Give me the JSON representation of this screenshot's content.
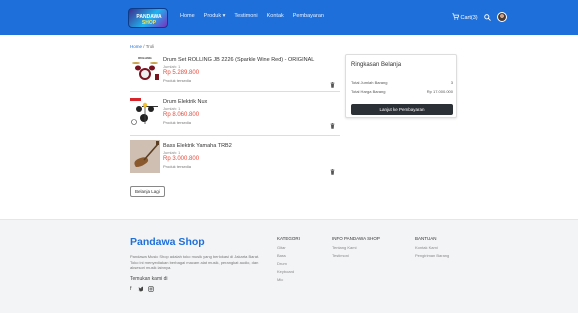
{
  "brand": {
    "logo_text": "Pandawa Shop"
  },
  "nav": {
    "links": [
      "Home",
      "Produk ▾",
      "Testimoni",
      "Kontak",
      "Pembayaran"
    ],
    "cart_label": "Cart(3)",
    "icons": [
      "cart-icon",
      "search-icon"
    ]
  },
  "breadcrumb": {
    "home": "Home",
    "sep": " / ",
    "current": "Troli"
  },
  "cart": {
    "items": [
      {
        "name": "Drum Set ROLLING JB 2226 (Sparkle Wine Red) - ORIGINAL",
        "qty": "Jumlah: 1",
        "price": "Rp 5.289.800",
        "stock": "Produk tersedia"
      },
      {
        "name": "Drum Elektrik Nux",
        "qty": "Jumlah: 1",
        "price": "Rp 8.060.800",
        "stock": "Produk tersedia"
      },
      {
        "name": "Bass Elektrik Yamaha TRB2",
        "qty": "Jumlah: 1",
        "price": "Rp 3.000.800",
        "stock": "Produk tersedia"
      }
    ],
    "continue_label": "Belanja Lagi"
  },
  "summary": {
    "title": "Ringkasan Belanja",
    "total_items_label": "Total Jumlah Barang",
    "total_items_value": "3",
    "total_price_label": "Total Harga Barang",
    "total_price_value": "Rp 17.000.000",
    "checkout_label": "Lanjut ke Pembayaran"
  },
  "footer": {
    "brand": "Pandawa Shop",
    "description": "Pandawa Music Shop adalah toko musik yang berlokasi di Jakarta Barat. Toko ini menyediakan berbagai macam alat musik, perangkat audio, dan aksesori musik lainnya.",
    "find_us": "Temukan kami di",
    "social_icons": [
      "facebook-icon",
      "twitter-icon",
      "instagram-icon"
    ],
    "columns": [
      {
        "title": "KATEGORI",
        "links": [
          "Gitar",
          "Bass",
          "Drum",
          "Keyboard",
          "Mic"
        ]
      },
      {
        "title": "INFO PANDAWA SHOP",
        "links": [
          "Tentang Kami",
          "Testimoni"
        ]
      },
      {
        "title": "BANTUAN",
        "links": [
          "Kontak Kami",
          "Pengiriman Barang"
        ]
      }
    ]
  },
  "colors": {
    "navbar": "#1e6fd9",
    "price": "#e64b3c",
    "checkout": "#2b2f36"
  }
}
